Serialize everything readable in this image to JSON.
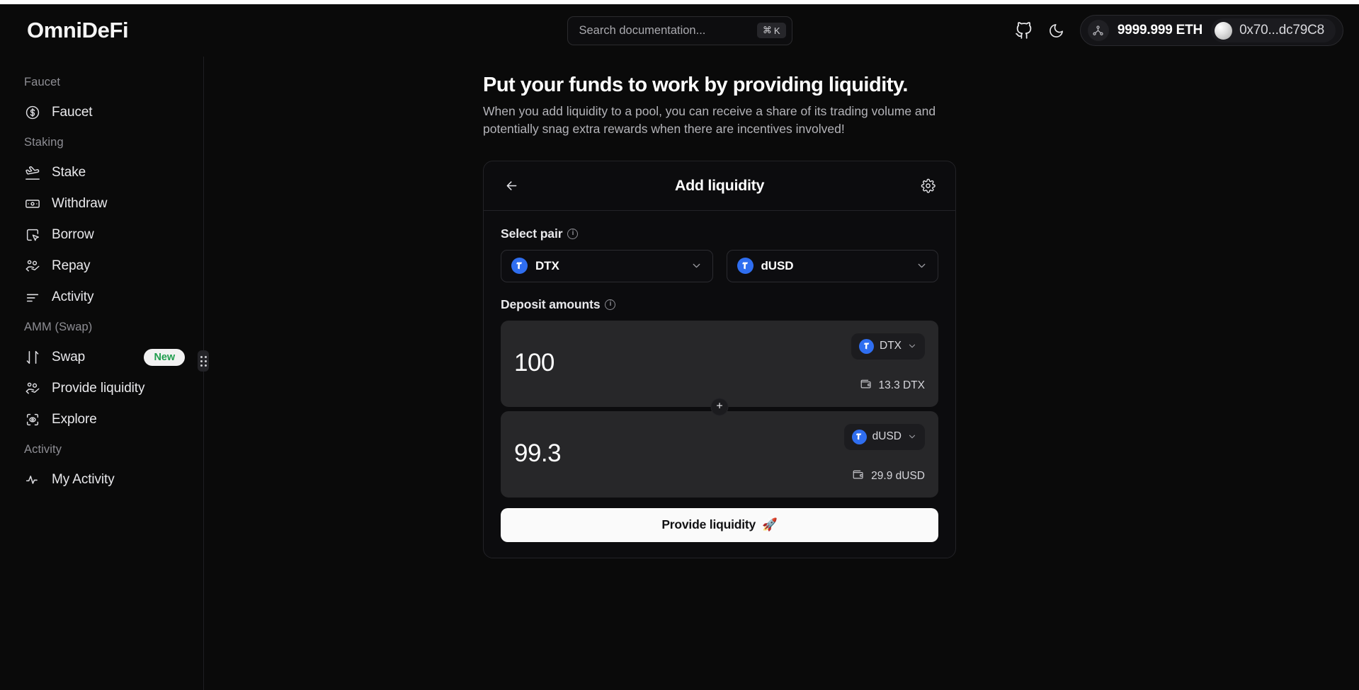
{
  "brand": "OmniDeFi",
  "search": {
    "placeholder": "Search documentation...",
    "shortcut_mod": "⌘",
    "shortcut_key": "K"
  },
  "header": {
    "github_icon": "github-icon",
    "theme_icon": "moon-icon",
    "network_icon": "network-nodes-icon",
    "eth_balance": "9999.999 ETH",
    "wallet_address": "0x70...dc79C8"
  },
  "sidebar": {
    "sections": [
      {
        "title": "Faucet",
        "items": [
          {
            "label": "Faucet",
            "icon": "dollar-circle-icon",
            "badge": null
          }
        ]
      },
      {
        "title": "Staking",
        "items": [
          {
            "label": "Stake",
            "icon": "plane-takeoff-icon",
            "badge": null
          },
          {
            "label": "Withdraw",
            "icon": "banknote-icon",
            "badge": null
          },
          {
            "label": "Borrow",
            "icon": "square-cursor-icon",
            "badge": null
          },
          {
            "label": "Repay",
            "icon": "hand-coins-icon",
            "badge": null
          },
          {
            "label": "Activity",
            "icon": "list-lines-icon",
            "badge": null
          }
        ]
      },
      {
        "title": "AMM (Swap)",
        "items": [
          {
            "label": "Swap",
            "icon": "arrows-up-down-icon",
            "badge": "New"
          },
          {
            "label": "Provide liquidity",
            "icon": "hand-coins-icon",
            "badge": null
          },
          {
            "label": "Explore",
            "icon": "eye-scan-icon",
            "badge": null
          }
        ]
      },
      {
        "title": "Activity",
        "items": [
          {
            "label": "My Activity",
            "icon": "pulse-icon",
            "badge": null
          }
        ]
      }
    ]
  },
  "main": {
    "title": "Put your funds to work by providing liquidity.",
    "subtitle": "When you add liquidity to a pool, you can receive a share of its trading volume and potentially snag extra rewards when there are incentives involved!"
  },
  "card": {
    "back_icon": "arrow-left-icon",
    "title": "Add liquidity",
    "settings_icon": "gear-icon",
    "select_pair_label": "Select pair",
    "select_pair_info_icon": "info-icon",
    "pair": [
      {
        "symbol": "DTX",
        "token_icon": "dtx-token-icon",
        "chevron_icon": "chevron-down-icon"
      },
      {
        "symbol": "dUSD",
        "token_icon": "dusd-token-icon",
        "chevron_icon": "chevron-down-icon"
      }
    ],
    "deposit_label": "Deposit amounts",
    "deposit_info_icon": "info-icon",
    "deposits": [
      {
        "amount": "100",
        "placeholder": "0",
        "symbol": "DTX",
        "token_icon": "dtx-token-icon",
        "chevron_icon": "chevron-down-icon",
        "wallet_icon": "wallet-icon",
        "balance": "13.3 DTX"
      },
      {
        "amount": "99.3",
        "placeholder": "0",
        "symbol": "dUSD",
        "token_icon": "dusd-token-icon",
        "chevron_icon": "chevron-down-icon",
        "wallet_icon": "wallet-icon",
        "balance": "29.9 dUSD"
      }
    ],
    "plus_icon": "plus-icon",
    "cta_label": "Provide liquidity",
    "cta_emoji": "🚀"
  },
  "colors": {
    "page_bg": "#0a0a0a",
    "card_bg": "#0c0c0e",
    "deposit_bg": "#272729",
    "token_blue": "#2f6ef0",
    "badge_green": "#1f9d4d",
    "cta_bg": "#fafafa"
  }
}
